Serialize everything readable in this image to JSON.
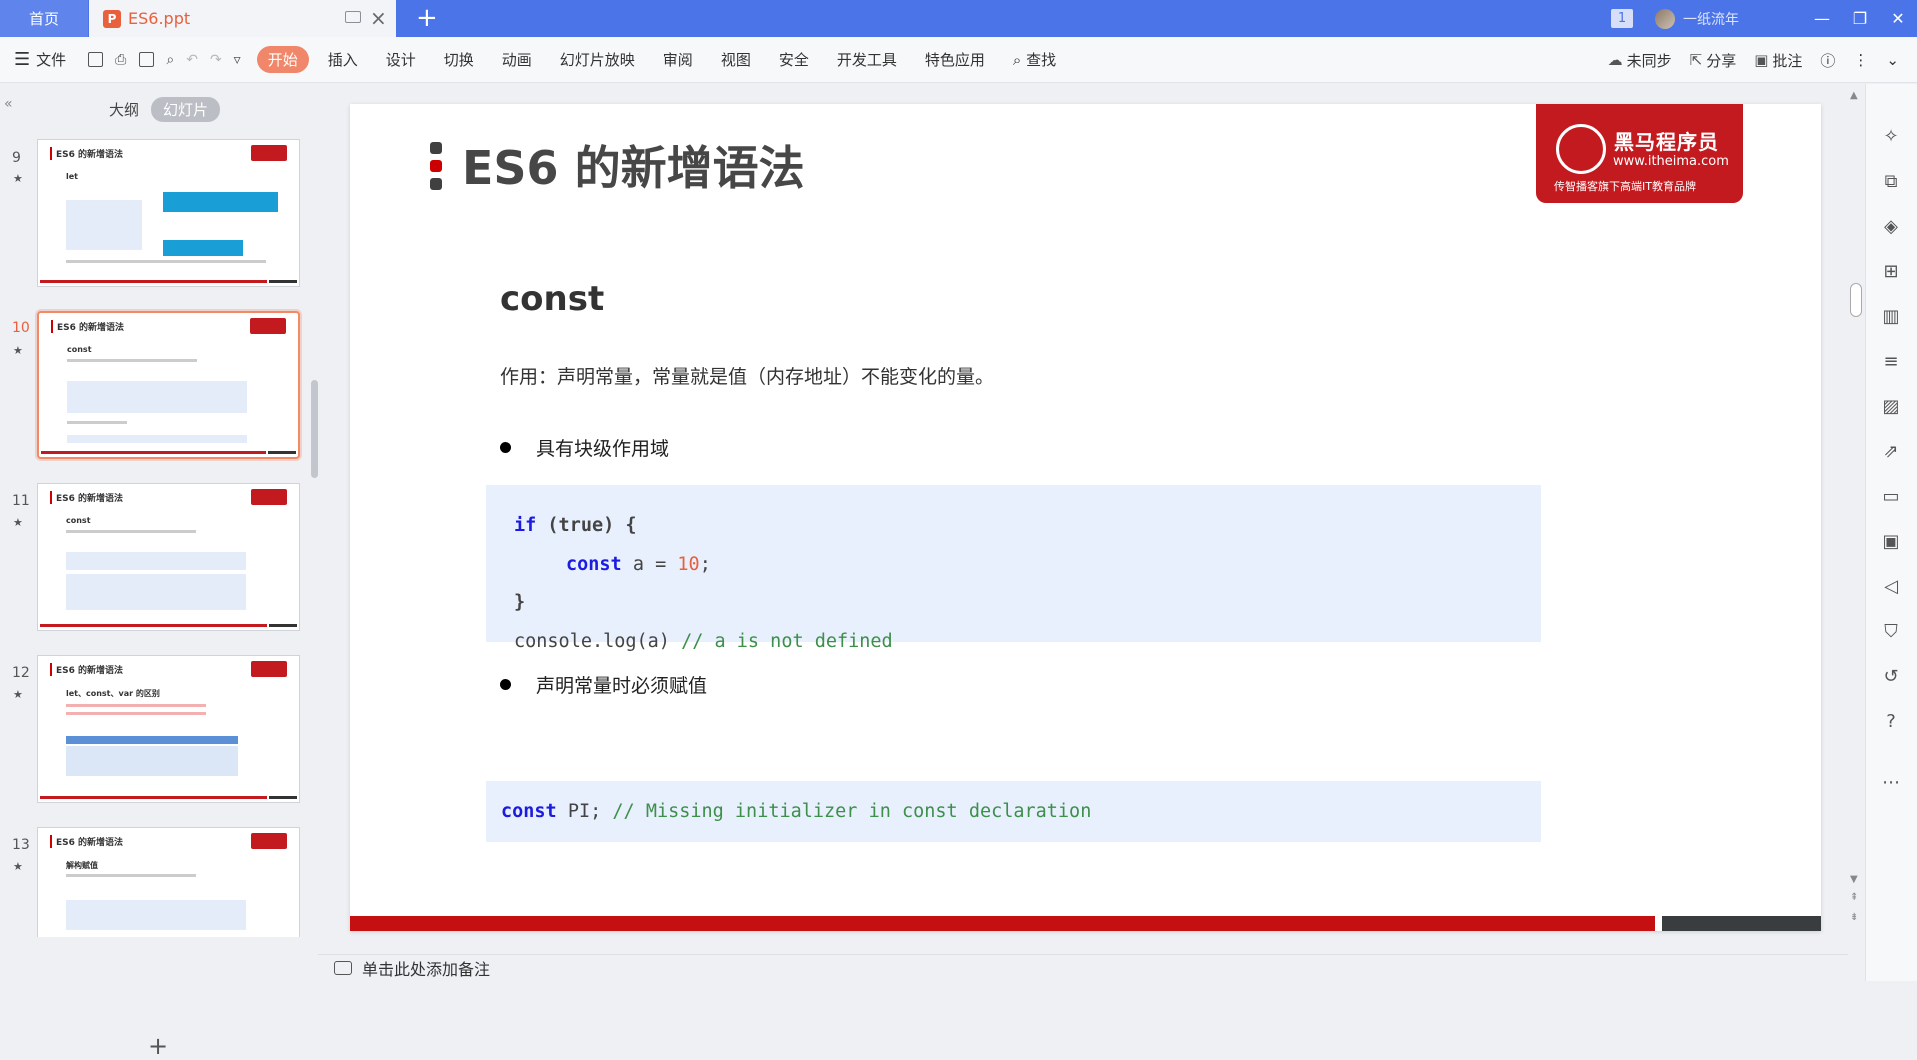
{
  "titlebar": {
    "home_tab": "首页",
    "doc_tab": "ES6.ppt",
    "doc_icon": "P",
    "new_tab": "+",
    "page_badge": "1",
    "username": "一纸流年",
    "minimize": "—",
    "restore": "❐",
    "close": "✕"
  },
  "toolbar": {
    "file_menu": "文件",
    "tabs": [
      "开始",
      "插入",
      "设计",
      "切换",
      "动画",
      "幻灯片放映",
      "审阅",
      "视图",
      "安全",
      "开发工具",
      "特色应用"
    ],
    "find": "查找",
    "sync": "未同步",
    "share": "分享",
    "comment": "批注"
  },
  "left_panel": {
    "view_tabs": [
      "大纲",
      "幻灯片"
    ],
    "thumbnails": [
      {
        "num": "9",
        "title": "ES6 的新增语法",
        "sub": "let"
      },
      {
        "num": "10",
        "title": "ES6 的新增语法",
        "sub": "const"
      },
      {
        "num": "11",
        "title": "ES6 的新增语法",
        "sub": "const"
      },
      {
        "num": "12",
        "title": "ES6 的新增语法",
        "sub": "let、const、var 的区别"
      },
      {
        "num": "13",
        "title": "ES6 的新增语法",
        "sub": "解构赋值"
      }
    ],
    "add_slide": "+"
  },
  "slide": {
    "title": "ES6 的新增语法",
    "logo_brand": "黑马程序员",
    "logo_url": "www.itheima.com",
    "logo_slogan": "传智播客旗下高端IT教育品牌",
    "section_title": "const",
    "description": "作用：声明常量，常量就是值（内存地址）不能变化的量。",
    "bullet1": "具有块级作用域",
    "bullet2": "声明常量时必须赋值",
    "code1": {
      "l1_kw": "if",
      "l1_rest": "(true) {",
      "l2_kw": "const",
      "l2_mid": " a = ",
      "l2_num": "10",
      "l2_end": ";",
      "l3": "}",
      "l4_code": "console.log(a)",
      "l4_comment": "// a is not defined"
    },
    "code2": {
      "kw": "const",
      "code": " PI;",
      "comment": " // Missing initializer in const declaration"
    }
  },
  "notes": {
    "placeholder": "单击此处添加备注"
  },
  "colors": {
    "titlebar": "#4a74e8",
    "accent": "#f0866a",
    "brand_red": "#c31a1f",
    "code_bg": "#e8f0fe"
  }
}
